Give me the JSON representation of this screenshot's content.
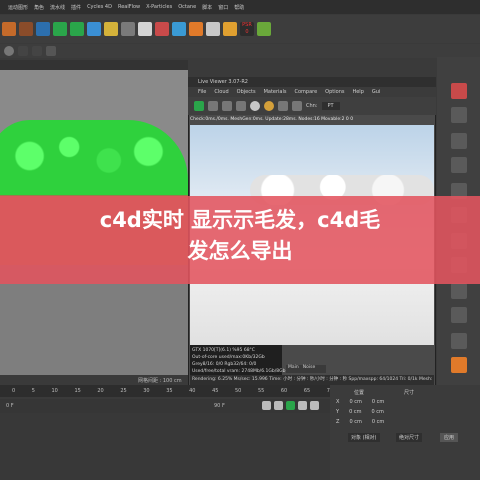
{
  "menubar": {
    "items": [
      "运动图形",
      "角色",
      "流水线",
      "插件",
      "Cycles 4D",
      "RealFlow",
      "X-Particles",
      "Octane",
      "脚本",
      "窗口",
      "帮助"
    ]
  },
  "live_viewer": {
    "title": "Live Viewer 3.07-R2",
    "menu": [
      "File",
      "Cloud",
      "Objects",
      "Materials",
      "Compare",
      "Options",
      "Help",
      "Gui"
    ],
    "channel_label": "Chn:",
    "channel_value": "PT",
    "status": "Check:0ms./0ms. MeshGen:0ms. Update:28ms. Nodes:16 Movable:2 0 0",
    "info": [
      "GTX 1070[T](6.1)   %95   68°C",
      "Out-of-core used/max:0Kb/32Gb",
      "Grey8/16: 0/0       Rgb32/64: 0/0",
      "Used/free/total vram: 2748Mb/6.1Gb/8Gb"
    ],
    "tabs": [
      "Main",
      "Noise"
    ],
    "footer": "Rendering: 6.25%   Ms/sec: 15.996   Time: 小时 : 分钟 : 秒/小时 : 分钟 : 秒   Spp/maxspp: 64/1024   Tri: 0/1k   Mesh: 1"
  },
  "viewport": {
    "grid_label": "网格间距 : 100 cm"
  },
  "timeline": {
    "ticks": [
      "0",
      "5",
      "10",
      "15",
      "20",
      "25",
      "30",
      "35",
      "40",
      "45",
      "50",
      "55",
      "60",
      "65",
      "70",
      "75",
      "80",
      "85",
      "90"
    ],
    "end_frame": "90 F",
    "current_frame": "0 F",
    "frame_counter": "0 F"
  },
  "attributes": {
    "header_pos": "位置",
    "header_size": "尺寸",
    "rows": [
      {
        "axis": "X",
        "pos": "0 cm",
        "size": "0 cm"
      },
      {
        "axis": "Y",
        "pos": "0 cm",
        "size": "0 cm"
      },
      {
        "axis": "Z",
        "pos": "0 cm",
        "size": "0 cm"
      }
    ],
    "mode": "对象 (相对)",
    "size_mode": "绝对尺寸",
    "apply": "应用"
  },
  "overlay": {
    "line1": "c4d实时 显示示毛发，c4d毛",
    "line2": "发怎么导出"
  },
  "psr": {
    "label": "PSR",
    "value": "0"
  },
  "colors": {
    "overlay": "#e2545e",
    "green": "#2fd13d",
    "viewer_sky": "#bcd3e8"
  }
}
